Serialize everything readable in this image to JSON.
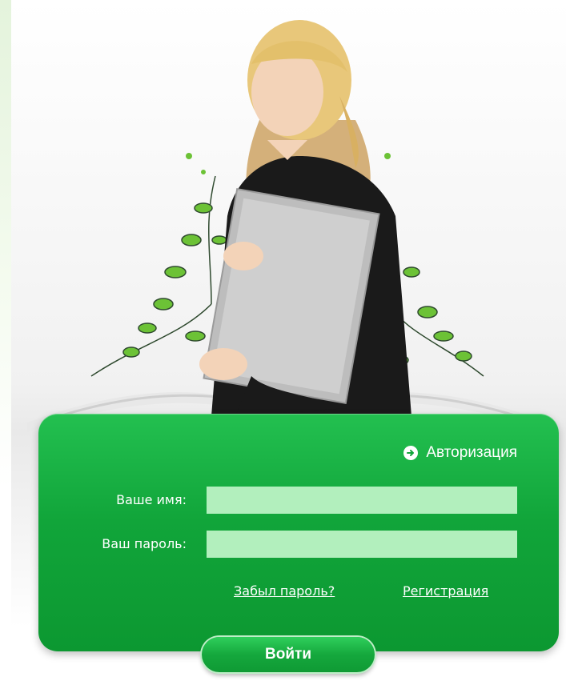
{
  "colors": {
    "accent_green": "#11a53a",
    "input_fill": "#b2efbd",
    "text_white": "#ffffff"
  },
  "login": {
    "title": "Авторизация",
    "title_icon": "arrow-circle-right-icon",
    "name_label": "Ваше имя:",
    "name_value": "",
    "password_label": "Ваш пароль:",
    "password_value": "",
    "forgot_link": "Забыл пароль?",
    "register_link": "Регистрация",
    "submit_label": "Войти"
  },
  "hero": {
    "illustration": "woman-holding-folder-with-floral-decoration"
  }
}
